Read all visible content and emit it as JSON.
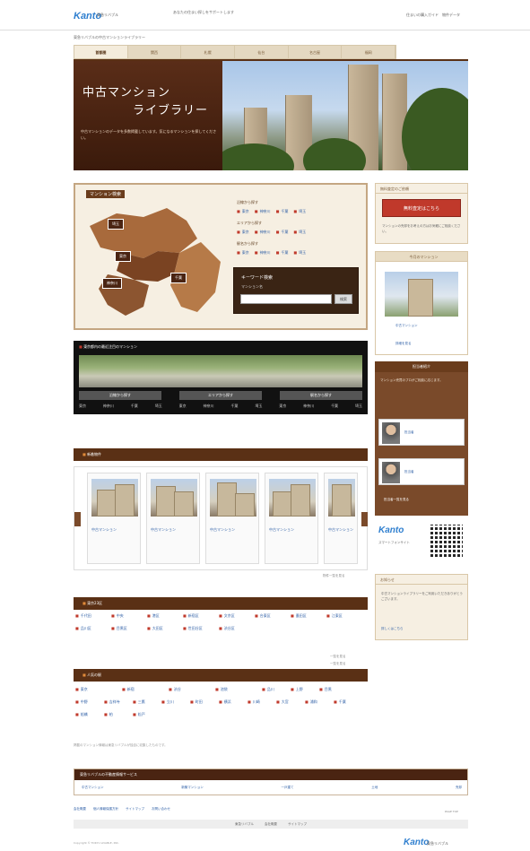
{
  "header": {
    "logo": "Kanto",
    "logo_sub": "東急リバブル",
    "message": "あなたの住まい探しをサポートします",
    "links": "住まいの購入ガイド　物件データ"
  },
  "breadcrumb": "東急リバブルの中古マンションライブラリー",
  "nav": {
    "tabs": [
      "首都圏",
      "関西",
      "札幌",
      "仙台",
      "名古屋",
      "福岡"
    ]
  },
  "hero": {
    "title_line1": "中古マンション",
    "title_line2": "ライブラリー",
    "description": "中古マンションのデータを多数掲載しています。気になるマンションを探してください。"
  },
  "search": {
    "title": "マンション検索",
    "regions": [
      "埼玉",
      "東京",
      "千葉",
      "神奈川"
    ],
    "area_groups": [
      {
        "title": "沿線から探す",
        "items": [
          "東京",
          "神奈川",
          "千葉",
          "埼玉"
        ]
      },
      {
        "title": "エリアから探す",
        "items": [
          "東京",
          "神奈川",
          "千葉",
          "埼玉"
        ]
      },
      {
        "title": "駅名から探す",
        "items": [
          "東京",
          "神奈川",
          "千葉",
          "埼玉"
        ]
      }
    ],
    "keyword": {
      "title": "キーワード検索",
      "radio": "マンション名",
      "button": "検索"
    }
  },
  "band": {
    "title": "東京都内の最近注目のマンション",
    "buttons": [
      "沿線から探す",
      "エリアから探す",
      "駅名から探す"
    ],
    "links": [
      "東京",
      "神奈川",
      "千葉",
      "埼玉",
      "東京",
      "神奈川",
      "千葉",
      "埼玉",
      "東京",
      "神奈川",
      "千葉",
      "埼玉"
    ]
  },
  "featured": {
    "title": "新着物件",
    "cards": [
      "中古マンション",
      "中古マンション",
      "中古マンション",
      "中古マンション",
      "中古マンション"
    ],
    "more": "物件一覧を見る"
  },
  "wards": {
    "title": "東京23区",
    "items": [
      "千代田",
      "中央",
      "港区",
      "新宿区",
      "文京区",
      "台東区",
      "墨田区",
      "江東区",
      "品川区",
      "目黒区",
      "大田区",
      "世田谷区",
      "渋谷区"
    ],
    "more": "一覧を見る"
  },
  "stations": {
    "title": "人気の駅",
    "items": [
      "東京",
      "新宿",
      "渋谷",
      "池袋",
      "品川",
      "上野",
      "目黒",
      "中野",
      "吉祥寺",
      "三鷹",
      "立川",
      "町田",
      "横浜",
      "川崎",
      "大宮",
      "浦和",
      "千葉",
      "船橋",
      "柏",
      "松戸"
    ],
    "more": "一覧を見る"
  },
  "disclaimer": "掲載のマンション情報は東急リバブルが独自に収集したものです。",
  "services": {
    "title": "東急リバブルの不動産情報サービス",
    "links": [
      "中古マンション",
      "新築マンション",
      "一戸建て",
      "土地",
      "売却"
    ]
  },
  "footer": {
    "links": [
      "会社概要",
      "個人情報保護方針",
      "サイトマップ",
      "お問い合わせ"
    ],
    "bar": [
      "東急リバブル",
      "会社概要",
      "サイトマップ"
    ],
    "copyright": "Copyright © TOKYU LIVABLE, INC.",
    "pagetop": "PAGE TOP",
    "logo": "Kanto",
    "logo_sub": "東急リバブル"
  },
  "sidebar": {
    "assess_title": "無料査定のご依頼",
    "assess_button": "無料査定はこちら",
    "assess_text": "マンションの売却をお考えの方はお気軽にご相談ください。",
    "photo_title": "今月のマンション",
    "photo_caption": "中古マンション",
    "photo_link": "詳細を見る",
    "staff_title": "担当者紹介",
    "staff_text": "マンション売買のプロがご相談に応じます。",
    "staff": [
      {
        "name": "担当者"
      },
      {
        "name": "担当者"
      }
    ],
    "staff_link": "担当者一覧を見る",
    "app_logo": "Kanto",
    "app_text": "スマートフォンサイト",
    "info_title": "お知らせ",
    "info_text": "中古マンションライブラリーをご利用いただきありがとうございます。",
    "info_link": "詳しくはこちら"
  }
}
